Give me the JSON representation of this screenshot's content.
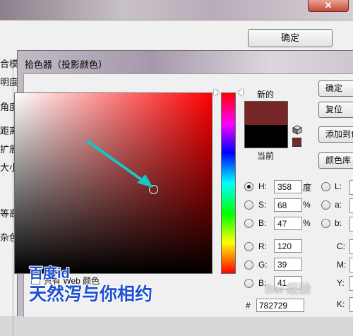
{
  "background_dialog": {
    "close_label": "✕",
    "ok_label": "确定",
    "labels": [
      "合模",
      "明度(",
      "角度(",
      "距离(",
      "扩展(",
      "大小(",
      "等高",
      "杂色("
    ]
  },
  "picker": {
    "title": "拾色器（投影颜色）",
    "new_label": "新的",
    "current_label": "当前",
    "new_color": "#782729",
    "current_color": "#000000",
    "web_only_label": "只有 Web 颜色",
    "buttons": {
      "ok": "确定",
      "reset": "复位",
      "add_swatches": "添加到色板",
      "color_libraries": "颜色库"
    },
    "hsb": {
      "h_label": "H:",
      "h_value": "358",
      "h_unit": "度",
      "s_label": "S:",
      "s_value": "68",
      "s_unit": "%",
      "b_label": "B:",
      "b_value": "47",
      "b_unit": "%"
    },
    "rgb": {
      "r_label": "R:",
      "r_value": "120",
      "g_label": "G:",
      "g_value": "39",
      "b_label": "B:",
      "b_value": "41"
    },
    "lab": {
      "l_label": "L:",
      "a_label": "a:",
      "b_label": "b:"
    },
    "cmyk": {
      "c_label": "C:",
      "m_label": "M:",
      "y_label": "Y:",
      "k_label": "K:"
    },
    "hex_label": "#",
    "hex_value": "782729"
  },
  "watermark": {
    "line1": "百度id",
    "line2": "天然泻与你相约",
    "logo": "Bai 经验"
  },
  "icons": {
    "cube": "cube-icon",
    "arrow": "pointer-arrow-icon"
  }
}
